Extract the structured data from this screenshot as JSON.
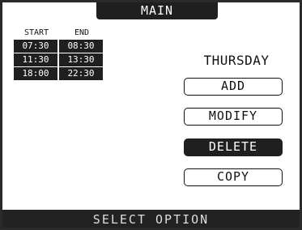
{
  "header": {
    "title": "MAIN"
  },
  "schedule": {
    "start_label": "START",
    "end_label": "END",
    "rows": [
      {
        "start": "07:30",
        "end": "08:30"
      },
      {
        "start": "11:30",
        "end": "13:30"
      },
      {
        "start": "18:00",
        "end": "22:30"
      }
    ]
  },
  "day": "THURSDAY",
  "options": [
    {
      "label": "ADD",
      "selected": false
    },
    {
      "label": "MODIFY",
      "selected": false
    },
    {
      "label": "DELETE",
      "selected": true
    },
    {
      "label": "COPY",
      "selected": false
    }
  ],
  "status": "SELECT OPTION",
  "colors": {
    "background": "#ffffff",
    "dark": "#1f1f1f",
    "text": "#111111"
  }
}
